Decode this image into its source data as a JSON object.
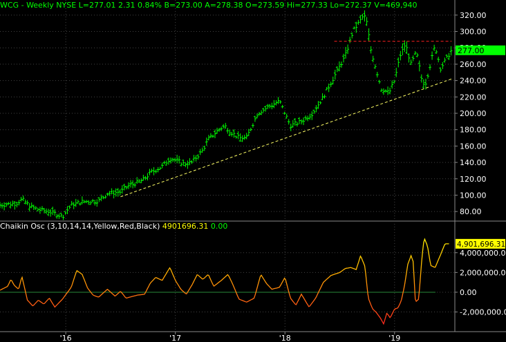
{
  "chart_data": [
    {
      "type": "ohlc",
      "header": {
        "symbol": "WCG",
        "period": "Weekly",
        "exchange": "NYSE",
        "last": "L=277.01",
        "change": "2.31",
        "change_pct": "0.84%",
        "bid": "B=273.00",
        "ask": "A=278.38",
        "open": "O=273.59",
        "high": "Hi=277.33",
        "low": "Lo=272.37",
        "volume": "V=469,940"
      },
      "last_price_label": "277.00",
      "ylim": [
        70,
        330
      ],
      "yticks": [
        "80.00",
        "100.00",
        "120.00",
        "140.00",
        "160.00",
        "180.00",
        "200.00",
        "220.00",
        "240.00",
        "260.00",
        "280.00",
        "300.00",
        "320.00"
      ],
      "ytick_values": [
        80,
        100,
        120,
        140,
        160,
        180,
        200,
        220,
        240,
        260,
        280,
        300,
        320
      ],
      "xticks": [
        "'16",
        "'17",
        "'18",
        "'19"
      ],
      "xtick_values": [
        2016.0,
        2017.0,
        2018.0,
        2019.0
      ],
      "xlim": [
        2015.4,
        2019.55
      ],
      "anchors": [
        [
          2015.4,
          88
        ],
        [
          2015.55,
          90
        ],
        [
          2015.6,
          95
        ],
        [
          2015.68,
          86
        ],
        [
          2015.76,
          82
        ],
        [
          2015.85,
          80
        ],
        [
          2015.97,
          74
        ],
        [
          2016.05,
          88
        ],
        [
          2016.15,
          92
        ],
        [
          2016.3,
          93
        ],
        [
          2016.38,
          102
        ],
        [
          2016.5,
          104
        ],
        [
          2016.58,
          112
        ],
        [
          2016.7,
          118
        ],
        [
          2016.78,
          128
        ],
        [
          2016.88,
          135
        ],
        [
          2016.95,
          145
        ],
        [
          2017.02,
          142
        ],
        [
          2017.08,
          138
        ],
        [
          2017.15,
          140
        ],
        [
          2017.25,
          155
        ],
        [
          2017.3,
          168
        ],
        [
          2017.38,
          178
        ],
        [
          2017.45,
          185
        ],
        [
          2017.5,
          178
        ],
        [
          2017.58,
          170
        ],
        [
          2017.65,
          170
        ],
        [
          2017.75,
          200
        ],
        [
          2017.85,
          208
        ],
        [
          2017.95,
          215
        ],
        [
          2018.05,
          185
        ],
        [
          2018.15,
          190
        ],
        [
          2018.25,
          200
        ],
        [
          2018.35,
          220
        ],
        [
          2018.45,
          245
        ],
        [
          2018.55,
          270
        ],
        [
          2018.62,
          300
        ],
        [
          2018.67,
          310
        ],
        [
          2018.72,
          320
        ],
        [
          2018.75,
          310
        ],
        [
          2018.78,
          280
        ],
        [
          2018.83,
          255
        ],
        [
          2018.88,
          230
        ],
        [
          2018.95,
          225
        ],
        [
          2019.0,
          240
        ],
        [
          2019.05,
          270
        ],
        [
          2019.1,
          285
        ],
        [
          2019.15,
          260
        ],
        [
          2019.2,
          275
        ],
        [
          2019.25,
          240
        ],
        [
          2019.28,
          235
        ],
        [
          2019.33,
          262
        ],
        [
          2019.37,
          283
        ],
        [
          2019.42,
          255
        ],
        [
          2019.48,
          268
        ],
        [
          2019.52,
          277
        ]
      ],
      "resistance_line": {
        "x": [
          2018.45,
          2019.52
        ],
        "y": [
          288,
          288
        ],
        "color": "#ff2020"
      },
      "support_line": {
        "x": [
          2016.5,
          2019.52
        ],
        "y": [
          98,
          242
        ],
        "color": "#ffff66"
      },
      "series_color": "#00ff00"
    },
    {
      "type": "line",
      "header_name": "Chaikin Osc (3,10,14,14,Yellow,Red,Black)",
      "header_value": "4901696.31",
      "header_signal": "0.00",
      "last_value_label": "4,901,696.31",
      "ylim": [
        -3500000,
        6500000
      ],
      "yticks": [
        "-2,000,000.00",
        "0.00",
        "2,000,000.00",
        "4,000,000.00"
      ],
      "ytick_values": [
        -2000000,
        0,
        2000000,
        4000000
      ],
      "xlim": [
        2015.4,
        2019.55
      ],
      "anchors": [
        [
          2015.4,
          200000
        ],
        [
          2015.47,
          600000
        ],
        [
          2015.5,
          1300000
        ],
        [
          2015.53,
          700000
        ],
        [
          2015.57,
          300000
        ],
        [
          2015.6,
          1600000
        ],
        [
          2015.65,
          -800000
        ],
        [
          2015.7,
          -1400000
        ],
        [
          2015.75,
          -800000
        ],
        [
          2015.8,
          -1200000
        ],
        [
          2015.85,
          -600000
        ],
        [
          2015.9,
          -1500000
        ],
        [
          2015.97,
          -700000
        ],
        [
          2016.05,
          500000
        ],
        [
          2016.1,
          2200000
        ],
        [
          2016.15,
          1800000
        ],
        [
          2016.2,
          400000
        ],
        [
          2016.25,
          -300000
        ],
        [
          2016.3,
          -500000
        ],
        [
          2016.38,
          300000
        ],
        [
          2016.45,
          -400000
        ],
        [
          2016.5,
          100000
        ],
        [
          2016.55,
          -600000
        ],
        [
          2016.65,
          -300000
        ],
        [
          2016.72,
          -200000
        ],
        [
          2016.77,
          900000
        ],
        [
          2016.82,
          1500000
        ],
        [
          2016.88,
          1200000
        ],
        [
          2016.95,
          2500000
        ],
        [
          2017.0,
          1200000
        ],
        [
          2017.05,
          300000
        ],
        [
          2017.1,
          -200000
        ],
        [
          2017.15,
          700000
        ],
        [
          2017.2,
          1800000
        ],
        [
          2017.25,
          1300000
        ],
        [
          2017.3,
          1800000
        ],
        [
          2017.35,
          600000
        ],
        [
          2017.42,
          1200000
        ],
        [
          2017.48,
          1800000
        ],
        [
          2017.52,
          900000
        ],
        [
          2017.58,
          -700000
        ],
        [
          2017.65,
          -1000000
        ],
        [
          2017.72,
          -600000
        ],
        [
          2017.78,
          1800000
        ],
        [
          2017.83,
          900000
        ],
        [
          2017.88,
          300000
        ],
        [
          2017.95,
          500000
        ],
        [
          2018.0,
          1500000
        ],
        [
          2018.05,
          -600000
        ],
        [
          2018.1,
          -1300000
        ],
        [
          2018.15,
          -200000
        ],
        [
          2018.22,
          -1500000
        ],
        [
          2018.28,
          -600000
        ],
        [
          2018.35,
          1000000
        ],
        [
          2018.42,
          1700000
        ],
        [
          2018.5,
          2000000
        ],
        [
          2018.55,
          2400000
        ],
        [
          2018.6,
          2500000
        ],
        [
          2018.65,
          2300000
        ],
        [
          2018.69,
          3700000
        ],
        [
          2018.73,
          2600000
        ],
        [
          2018.76,
          -600000
        ],
        [
          2018.8,
          -1700000
        ],
        [
          2018.83,
          -2000000
        ],
        [
          2018.87,
          -2600000
        ],
        [
          2018.9,
          -3200000
        ],
        [
          2018.93,
          -2100000
        ],
        [
          2018.96,
          -2600000
        ],
        [
          2019.0,
          -1700000
        ],
        [
          2019.03,
          -1600000
        ],
        [
          2019.06,
          -900000
        ],
        [
          2019.09,
          600000
        ],
        [
          2019.12,
          2800000
        ],
        [
          2019.15,
          3700000
        ],
        [
          2019.17,
          3100000
        ],
        [
          2019.19,
          -1000000
        ],
        [
          2019.22,
          -700000
        ],
        [
          2019.25,
          3500000
        ],
        [
          2019.27,
          5500000
        ],
        [
          2019.3,
          4700000
        ],
        [
          2019.33,
          2700000
        ],
        [
          2019.37,
          2500000
        ],
        [
          2019.42,
          3800000
        ],
        [
          2019.46,
          4900000
        ],
        [
          2019.5,
          4901696
        ]
      ],
      "zero_line_color": "#2a8a3a",
      "colors": {
        "high": "#ffff00",
        "low": "#ff2020"
      }
    }
  ]
}
